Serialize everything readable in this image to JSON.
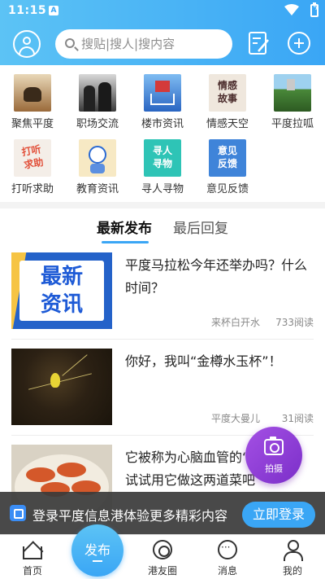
{
  "status_bar": {
    "time": "11:15",
    "alert_badge": "A"
  },
  "header": {
    "search_placeholder": "搜贴|搜人|搜内容",
    "accent_color": "#3aa6f5",
    "icons": [
      "user-icon",
      "search-icon",
      "edit-icon",
      "plus-icon"
    ]
  },
  "categories": [
    {
      "label": "聚焦平度",
      "icon": "tea-set-photo"
    },
    {
      "label": "职场交流",
      "icon": "business-people-photo"
    },
    {
      "label": "楼市资讯",
      "icon": "house-cart-photo"
    },
    {
      "label": "情感天空",
      "icon": "emotion-story-photo",
      "thumb_text": "情感\n故事"
    },
    {
      "label": "平度拉呱",
      "icon": "city-landscape-photo"
    },
    {
      "label": "打听求助",
      "icon": "help-badge",
      "thumb_text": "打听\n求助"
    },
    {
      "label": "教育资讯",
      "icon": "astronaut-photo"
    },
    {
      "label": "寻人寻物",
      "icon": "search-people-badge",
      "thumb_text": "寻人\n寻物"
    },
    {
      "label": "意见反馈",
      "icon": "feedback-badge",
      "thumb_text": "意见\n反馈"
    }
  ],
  "tabs": {
    "latest": "最新发布",
    "last_reply": "最后回复"
  },
  "articles": [
    {
      "title": "平度马拉松今年还举办吗？什么时间？",
      "author": "来杯白开水",
      "reads": "733阅读",
      "image_text": "最新\n资讯"
    },
    {
      "title": "你好，我叫“金樽水玉杯”！",
      "author": "平度大曼儿",
      "reads": "31阅读"
    },
    {
      "title": "它被称为心脑血管的“保护伞”，试试用它做这两道菜吧",
      "author": "",
      "reads": ""
    }
  ],
  "camera_fab": {
    "label": "拍摄"
  },
  "login_banner": {
    "text": "登录平度信息港体验更多精彩内容",
    "button": "立即登录"
  },
  "bottom_nav": {
    "home": "首页",
    "publish": "发布",
    "circle": "港友圈",
    "messages": "消息",
    "me": "我的"
  }
}
